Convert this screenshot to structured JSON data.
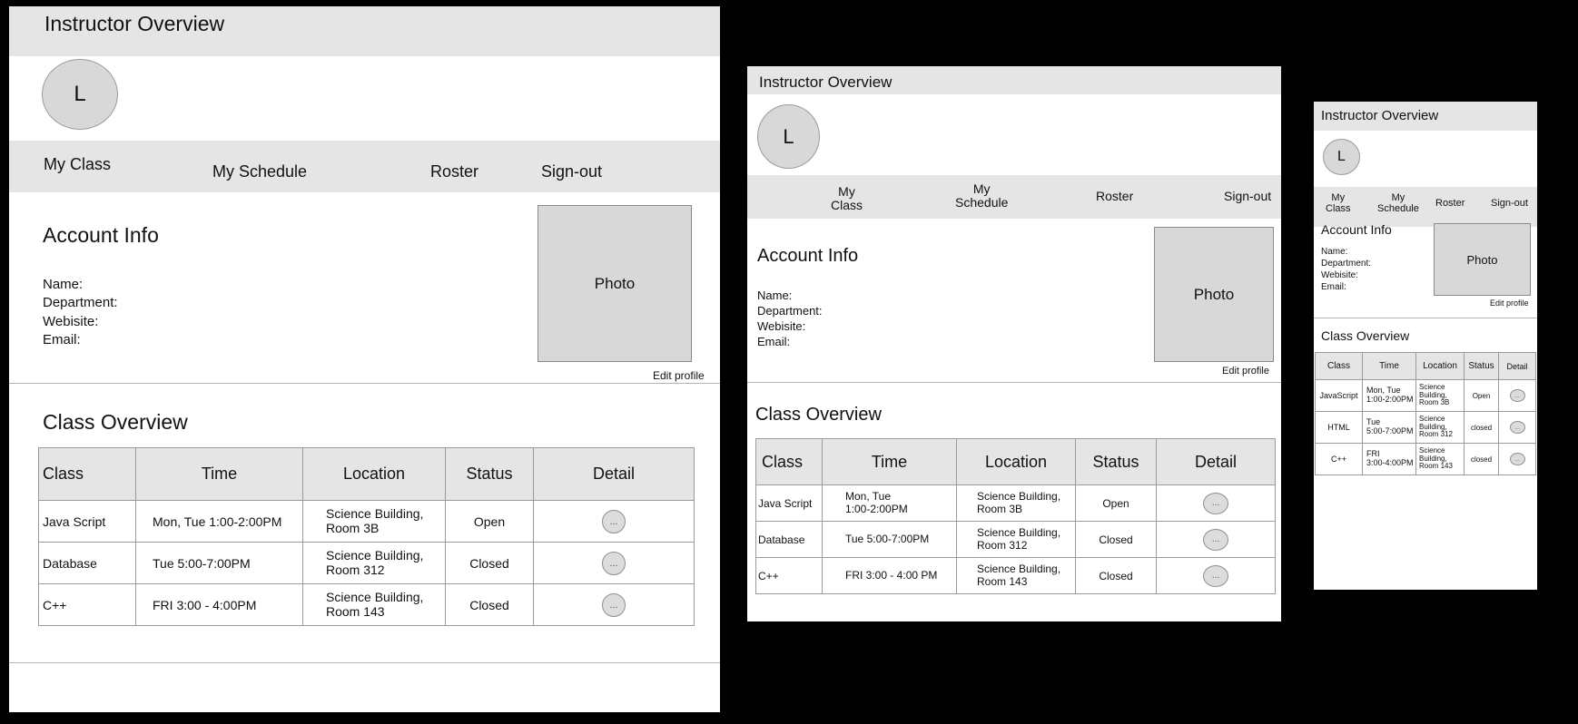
{
  "app": {
    "title": "Instructor Overview",
    "avatar_initial": "L"
  },
  "nav": {
    "my_class": "My Class",
    "my_schedule": "My Schedule",
    "my_class_l1": "My",
    "my_class_l2": "Class",
    "my_schedule_l1": "My",
    "my_schedule_l2": "Schedule",
    "roster": "Roster",
    "signout": "Sign-out"
  },
  "account": {
    "heading": "Account Info",
    "name_label": "Name:",
    "department_label": "Department:",
    "website_label": "Webisite:",
    "email_label": "Email:",
    "photo_label": "Photo",
    "edit_profile": "Edit profile"
  },
  "overview": {
    "heading": "Class Overview",
    "columns": {
      "class": "Class",
      "time": "Time",
      "location": "Location",
      "status": "Status",
      "detail": "Detail"
    },
    "detail_button": "..."
  },
  "frame1": {
    "rows": [
      {
        "class": "Java Script",
        "time": "Mon, Tue 1:00-2:00PM",
        "loc1": "Science Building,",
        "loc2": "Room 3B",
        "status": "Open"
      },
      {
        "class": "Database",
        "time": "Tue 5:00-7:00PM",
        "loc1": "Science Building,",
        "loc2": "Room 312",
        "status": "Closed"
      },
      {
        "class": "C++",
        "time": "FRI 3:00 - 4:00PM",
        "loc1": "Science Building,",
        "loc2": "Room 143",
        "status": "Closed"
      }
    ]
  },
  "frame2": {
    "rows": [
      {
        "class": "Java Script",
        "time1": "Mon, Tue",
        "time2": "1:00-2:00PM",
        "loc1": "Science Building,",
        "loc2": "Room 3B",
        "status": "Open"
      },
      {
        "class": "Database",
        "time1": "Tue 5:00-7:00PM",
        "time2": "",
        "loc1": "Science Building,",
        "loc2": "Room 312",
        "status": "Closed"
      },
      {
        "class": "C++",
        "time1": "FRI 3:00 - 4:00 PM",
        "time2": "",
        "loc1": "Science Building,",
        "loc2": "Room 143",
        "status": "Closed"
      }
    ]
  },
  "frame3": {
    "rows": [
      {
        "class": "JavaScript",
        "time1": "Mon, Tue",
        "time2": "1:00-2:00PM",
        "loc1": "Science",
        "loc2": "Building,",
        "loc3": "Room 3B",
        "status": "Open"
      },
      {
        "class": "HTML",
        "time1": "Tue",
        "time2": "5:00-7:00PM",
        "loc1": "Science",
        "loc2": "Building,",
        "loc3": "Room 312",
        "status": "closed"
      },
      {
        "class": "C++",
        "time1": "FRI",
        "time2": "3:00-4:00PM",
        "loc1": "Science",
        "loc2": "Building,",
        "loc3": "Room 143",
        "status": "closed"
      }
    ]
  }
}
